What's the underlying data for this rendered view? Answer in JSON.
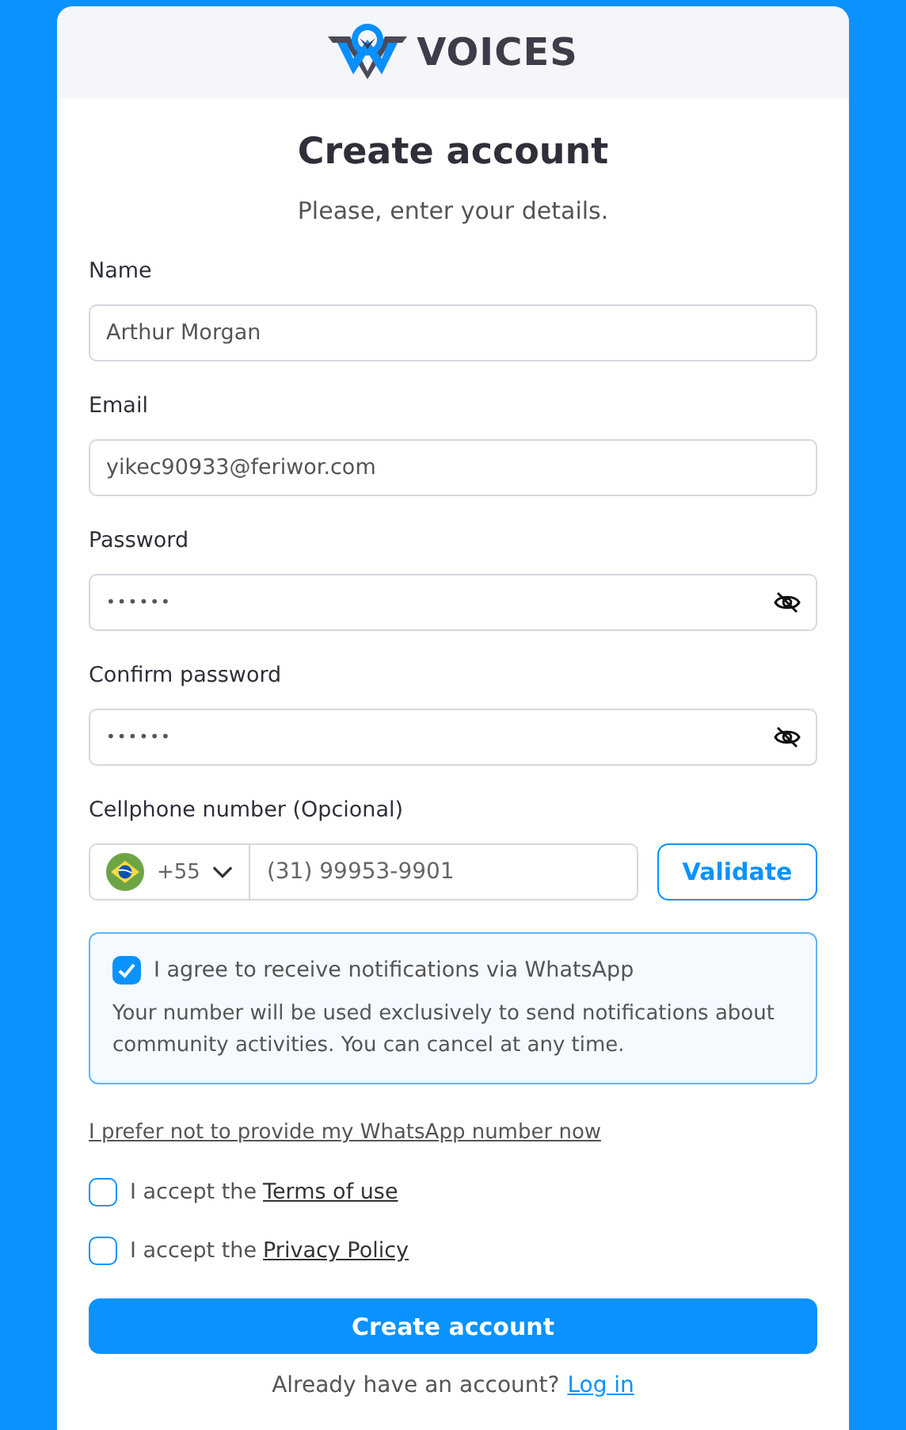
{
  "logo": {
    "text": "VOICES"
  },
  "title": "Create account",
  "subtitle": "Please, enter your details.",
  "fields": [
    {
      "kind": "text",
      "label": "Name",
      "value": "Arthur Morgan"
    },
    {
      "kind": "text",
      "label": "Email",
      "value": "yikec90933@feriwor.com"
    },
    {
      "kind": "password",
      "label": "Password",
      "value": "••••••"
    },
    {
      "kind": "password",
      "label": "Confirm password",
      "value": "••••••"
    }
  ],
  "phone": {
    "label": "Cellphone number (Opcional)",
    "country_code": "+55",
    "value": "(31) 99953-9901",
    "button": "Validate"
  },
  "whatsapp": {
    "checked": true,
    "label": "I agree to receive notifications via WhatsApp",
    "note": "Your number will be used exclusively to send notifications about community activities. You can cancel at any time."
  },
  "skip_link": "I prefer not to provide my WhatsApp number now",
  "consents": [
    {
      "checked": false,
      "text": "I accept the",
      "link": "Terms of use"
    },
    {
      "checked": false,
      "text": "I accept the",
      "link": "Privacy Policy"
    }
  ],
  "submit": "Create account",
  "footer": {
    "text": "Already have an account?",
    "link": "Log in"
  }
}
